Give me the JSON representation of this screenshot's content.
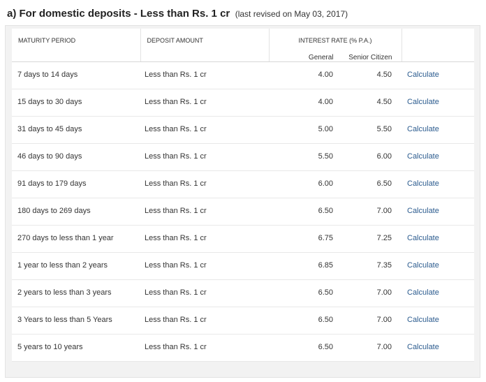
{
  "heading": {
    "title": "a) For domestic deposits - Less than Rs. 1 cr",
    "note": "(last revised on May 03, 2017)"
  },
  "table": {
    "headers": {
      "maturity": "MATURITY PERIOD",
      "amount": "DEPOSIT AMOUNT",
      "rate": "INTEREST RATE (% p.a.)",
      "general": "General",
      "senior": "Senior Citizen"
    },
    "rows": [
      {
        "period": "7 days to 14 days",
        "amount": "Less than Rs. 1 cr",
        "general": "4.00",
        "senior": "4.50",
        "action": "Calculate"
      },
      {
        "period": "15 days to 30 days",
        "amount": "Less than Rs. 1 cr",
        "general": "4.00",
        "senior": "4.50",
        "action": "Calculate"
      },
      {
        "period": "31 days to 45 days",
        "amount": "Less than Rs. 1 cr",
        "general": "5.00",
        "senior": "5.50",
        "action": "Calculate"
      },
      {
        "period": "46 days to 90 days",
        "amount": "Less than Rs. 1 cr",
        "general": "5.50",
        "senior": "6.00",
        "action": "Calculate"
      },
      {
        "period": "91 days to 179 days",
        "amount": "Less than Rs. 1 cr",
        "general": "6.00",
        "senior": "6.50",
        "action": "Calculate"
      },
      {
        "period": "180 days to 269 days",
        "amount": "Less than Rs. 1 cr",
        "general": "6.50",
        "senior": "7.00",
        "action": "Calculate"
      },
      {
        "period": "270 days to less than 1 year",
        "amount": "Less than Rs. 1 cr",
        "general": "6.75",
        "senior": "7.25",
        "action": "Calculate"
      },
      {
        "period": "1 year to less than 2 years",
        "amount": "Less than Rs. 1 cr",
        "general": "6.85",
        "senior": "7.35",
        "action": "Calculate"
      },
      {
        "period": "2 years to less than 3 years",
        "amount": "Less than Rs. 1 cr",
        "general": "6.50",
        "senior": "7.00",
        "action": "Calculate"
      },
      {
        "period": "3 Years to less than 5 Years",
        "amount": "Less than Rs. 1 cr",
        "general": "6.50",
        "senior": "7.00",
        "action": "Calculate"
      },
      {
        "period": "5 years to 10 years",
        "amount": "Less than Rs. 1 cr",
        "general": "6.50",
        "senior": "7.00",
        "action": "Calculate"
      }
    ]
  },
  "colors": {
    "link": "#2c5c8f",
    "panel_bg": "#f2f2f2",
    "border": "#e3e3e3"
  }
}
